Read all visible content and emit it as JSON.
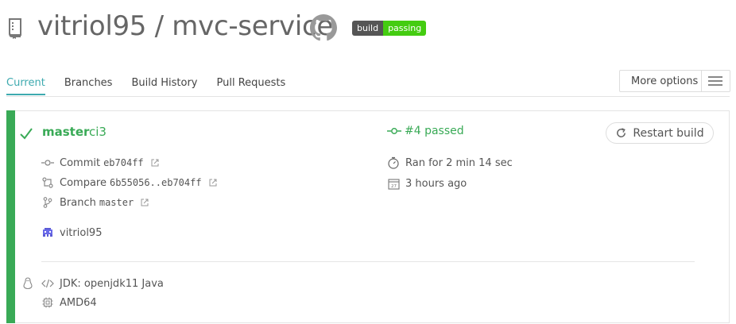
{
  "header": {
    "repo_title": "vitriol95 / mvc-service",
    "badge_left": "build",
    "badge_right": "passing"
  },
  "tabs": [
    {
      "label": "Current",
      "active": true
    },
    {
      "label": "Branches",
      "active": false
    },
    {
      "label": "Build History",
      "active": false
    },
    {
      "label": "Pull Requests",
      "active": false
    }
  ],
  "more_options": {
    "label": "More options"
  },
  "build": {
    "branch": "master",
    "message": "ci3",
    "status": "#4 passed",
    "restart_label": "Restart build",
    "commit_label": "Commit",
    "commit_sha": "eb704ff",
    "compare_label": "Compare",
    "compare_range": "6b55056..eb704ff",
    "branch_label": "Branch",
    "branch_value": "master",
    "author": "vitriol95",
    "duration": "Ran for 2 min 14 sec",
    "finished": "3 hours ago",
    "jdk": "JDK: openjdk11 Java",
    "arch": "AMD64"
  },
  "colors": {
    "passed": "#39aa56",
    "tab_active": "#3eaaaf"
  }
}
